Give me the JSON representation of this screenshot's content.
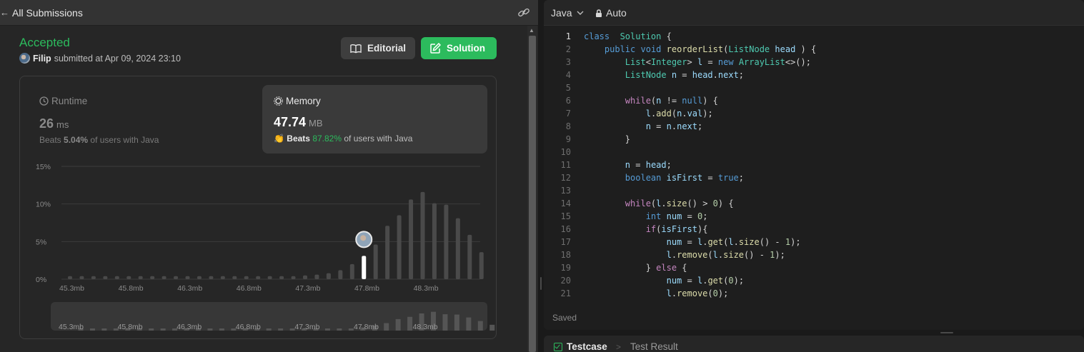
{
  "left": {
    "header_title": "All Submissions",
    "status": "Accepted",
    "submitter_name": "Filip",
    "submitted_text": "submitted at Apr 09, 2024 23:10",
    "editorial_label": "Editorial",
    "solution_label": "Solution",
    "runtime": {
      "label": "Runtime",
      "value": "26",
      "unit": "ms",
      "beats_prefix": "Beats",
      "beats_pct": "5.04%",
      "beats_suffix": "of users with Java"
    },
    "memory": {
      "label": "Memory",
      "value": "47.74",
      "unit": "MB",
      "beats_prefix": "Beats",
      "beats_pct": "87.82%",
      "beats_suffix": "of users with Java"
    }
  },
  "chart_data": {
    "type": "bar",
    "title": "",
    "xlabel": "",
    "ylabel": "",
    "ylim": [
      0,
      15
    ],
    "y_ticks": [
      "15%",
      "10%",
      "5%",
      "0%"
    ],
    "x_tick_labels": [
      "45.3mb",
      "45.8mb",
      "46.3mb",
      "46.8mb",
      "47.3mb",
      "47.8mb",
      "48.3mb"
    ],
    "values": [
      0.4,
      0.4,
      0.4,
      0.4,
      0.4,
      0.4,
      0.4,
      0.4,
      0.4,
      0.4,
      0.4,
      0.4,
      0.4,
      0.4,
      0.4,
      0.4,
      0.4,
      0.4,
      0.4,
      0.4,
      0.5,
      0.6,
      0.8,
      1.2,
      2.0,
      3.1,
      4.6,
      7.1,
      8.5,
      10.6,
      11.6,
      10.1,
      9.9,
      8.1,
      5.9,
      3.6
    ],
    "highlight_index": 25,
    "grid": true,
    "minimap_values": [
      0.4,
      0.4,
      0.4,
      0.4,
      0.4,
      0.4,
      0.4,
      0.4,
      0.4,
      0.4,
      0.4,
      0.4,
      0.4,
      0.4,
      0.4,
      0.4,
      0.4,
      0.4,
      0.4,
      0.4,
      0.5,
      0.6,
      0.8,
      1.2,
      2.0,
      3.1,
      4.6,
      7.1,
      8.5,
      10.6,
      11.6,
      10.1,
      9.9,
      8.1,
      5.9,
      3.6
    ]
  },
  "editor": {
    "language": "Java",
    "mode": "Auto",
    "saved_label": "Saved",
    "active_line": 1,
    "lines": [
      [
        [
          "kw2",
          "class"
        ],
        [
          "",
          "  "
        ],
        [
          "ty",
          "Solution"
        ],
        [
          "",
          " {"
        ]
      ],
      [
        [
          "",
          "    "
        ],
        [
          "kw2",
          "public"
        ],
        [
          "",
          " "
        ],
        [
          "kw2",
          "void"
        ],
        [
          "",
          " "
        ],
        [
          "fn",
          "reorderList"
        ],
        [
          "",
          "("
        ],
        [
          "ty",
          "ListNode"
        ],
        [
          "",
          " "
        ],
        [
          "vr",
          "head"
        ],
        [
          "",
          " ) {"
        ]
      ],
      [
        [
          "",
          "        "
        ],
        [
          "ty",
          "List"
        ],
        [
          "",
          "<"
        ],
        [
          "ty",
          "Integer"
        ],
        [
          "",
          "> "
        ],
        [
          "vr",
          "l"
        ],
        [
          "",
          " = "
        ],
        [
          "kw2",
          "new"
        ],
        [
          "",
          " "
        ],
        [
          "ty",
          "ArrayList"
        ],
        [
          "",
          "<>();"
        ]
      ],
      [
        [
          "",
          "        "
        ],
        [
          "ty",
          "ListNode"
        ],
        [
          "",
          " "
        ],
        [
          "vr",
          "n"
        ],
        [
          "",
          " = "
        ],
        [
          "vr",
          "head"
        ],
        [
          "",
          "."
        ],
        [
          "vr",
          "next"
        ],
        [
          "",
          ";"
        ]
      ],
      [
        [
          "",
          ""
        ]
      ],
      [
        [
          "",
          "        "
        ],
        [
          "kw",
          "while"
        ],
        [
          "",
          "("
        ],
        [
          "vr",
          "n"
        ],
        [
          "",
          " != "
        ],
        [
          "kw2",
          "null"
        ],
        [
          "",
          ") {"
        ]
      ],
      [
        [
          "",
          "            "
        ],
        [
          "vr",
          "l"
        ],
        [
          "",
          "."
        ],
        [
          "fn",
          "add"
        ],
        [
          "",
          "("
        ],
        [
          "vr",
          "n"
        ],
        [
          "",
          "."
        ],
        [
          "vr",
          "val"
        ],
        [
          "",
          ");"
        ]
      ],
      [
        [
          "",
          "            "
        ],
        [
          "vr",
          "n"
        ],
        [
          "",
          " = "
        ],
        [
          "vr",
          "n"
        ],
        [
          "",
          "."
        ],
        [
          "vr",
          "next"
        ],
        [
          "",
          ";"
        ]
      ],
      [
        [
          "",
          "        }"
        ]
      ],
      [
        [
          "",
          ""
        ]
      ],
      [
        [
          "",
          "        "
        ],
        [
          "vr",
          "n"
        ],
        [
          "",
          " = "
        ],
        [
          "vr",
          "head"
        ],
        [
          "",
          ";"
        ]
      ],
      [
        [
          "",
          "        "
        ],
        [
          "kw2",
          "boolean"
        ],
        [
          "",
          " "
        ],
        [
          "vr",
          "isFirst"
        ],
        [
          "",
          " = "
        ],
        [
          "kw2",
          "true"
        ],
        [
          "",
          ";"
        ]
      ],
      [
        [
          "",
          ""
        ]
      ],
      [
        [
          "",
          "        "
        ],
        [
          "kw",
          "while"
        ],
        [
          "",
          "("
        ],
        [
          "vr",
          "l"
        ],
        [
          "",
          "."
        ],
        [
          "fn",
          "size"
        ],
        [
          "",
          "() > "
        ],
        [
          "nm",
          "0"
        ],
        [
          "",
          ") {"
        ]
      ],
      [
        [
          "",
          "            "
        ],
        [
          "kw2",
          "int"
        ],
        [
          "",
          " "
        ],
        [
          "vr",
          "num"
        ],
        [
          "",
          " = "
        ],
        [
          "nm",
          "0"
        ],
        [
          "",
          ";"
        ]
      ],
      [
        [
          "",
          "            "
        ],
        [
          "kw",
          "if"
        ],
        [
          "",
          "("
        ],
        [
          "vr",
          "isFirst"
        ],
        [
          "",
          "){"
        ]
      ],
      [
        [
          "",
          "                "
        ],
        [
          "vr",
          "num"
        ],
        [
          "",
          " = "
        ],
        [
          "vr",
          "l"
        ],
        [
          "",
          "."
        ],
        [
          "fn",
          "get"
        ],
        [
          "",
          "("
        ],
        [
          "vr",
          "l"
        ],
        [
          "",
          "."
        ],
        [
          "fn",
          "size"
        ],
        [
          "",
          "() - "
        ],
        [
          "nm",
          "1"
        ],
        [
          "",
          ");"
        ]
      ],
      [
        [
          "",
          "                "
        ],
        [
          "vr",
          "l"
        ],
        [
          "",
          "."
        ],
        [
          "fn",
          "remove"
        ],
        [
          "",
          "("
        ],
        [
          "vr",
          "l"
        ],
        [
          "",
          "."
        ],
        [
          "fn",
          "size"
        ],
        [
          "",
          "() - "
        ],
        [
          "nm",
          "1"
        ],
        [
          "",
          ");"
        ]
      ],
      [
        [
          "",
          "            } "
        ],
        [
          "kw",
          "else"
        ],
        [
          "",
          " {"
        ]
      ],
      [
        [
          "",
          "                "
        ],
        [
          "vr",
          "num"
        ],
        [
          "",
          " = "
        ],
        [
          "vr",
          "l"
        ],
        [
          "",
          "."
        ],
        [
          "fn",
          "get"
        ],
        [
          "",
          "("
        ],
        [
          "nm",
          "0"
        ],
        [
          "",
          ");"
        ]
      ],
      [
        [
          "",
          "                "
        ],
        [
          "vr",
          "l"
        ],
        [
          "",
          "."
        ],
        [
          "fn",
          "remove"
        ],
        [
          "",
          "("
        ],
        [
          "nm",
          "0"
        ],
        [
          "",
          ");"
        ]
      ]
    ]
  },
  "bottom": {
    "testcase_label": "Testcase",
    "result_label": "Test Result"
  },
  "colors": {
    "accent_green": "#2cbb5d",
    "panel_bg": "#262626",
    "editor_bg": "#1e1e1e"
  },
  "icons": {
    "back": "arrow-left-icon",
    "link": "link-icon",
    "editorial": "book-icon",
    "solution": "edit-icon",
    "runtime": "clock-icon",
    "memory": "chip-icon",
    "beats": "clap-icon",
    "lang": "chevron-down-icon",
    "lock": "lock-icon",
    "testcase": "checkbox-icon",
    "result": "terminal-icon"
  }
}
